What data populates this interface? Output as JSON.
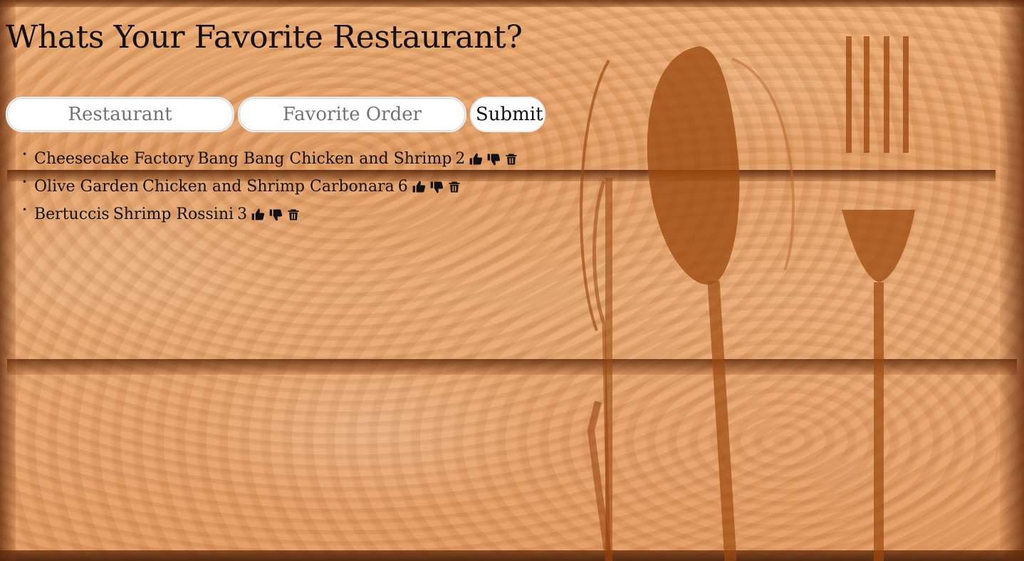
{
  "page": {
    "title": "Whats Your Favorite Restaurant?"
  },
  "form": {
    "restaurant_placeholder": "Restaurant",
    "order_placeholder": "Favorite Order",
    "submit_label": "Submit"
  },
  "favorites": [
    {
      "restaurant": "Cheesecake Factory",
      "order": "Bang Bang Chicken and Shrimp",
      "votes": "2"
    },
    {
      "restaurant": "Olive Garden",
      "order": "Chicken and Shrimp Carbonara",
      "votes": "6"
    },
    {
      "restaurant": "Bertuccis",
      "order": "Shrimp Rossini",
      "votes": "3"
    }
  ],
  "icons": {
    "upvote": "thumbs-up-icon",
    "downvote": "thumbs-down-icon",
    "delete": "trash-icon"
  },
  "colors": {
    "text": "#111111",
    "input_background": "#ffffff",
    "wood_primary": "#e4a169"
  }
}
